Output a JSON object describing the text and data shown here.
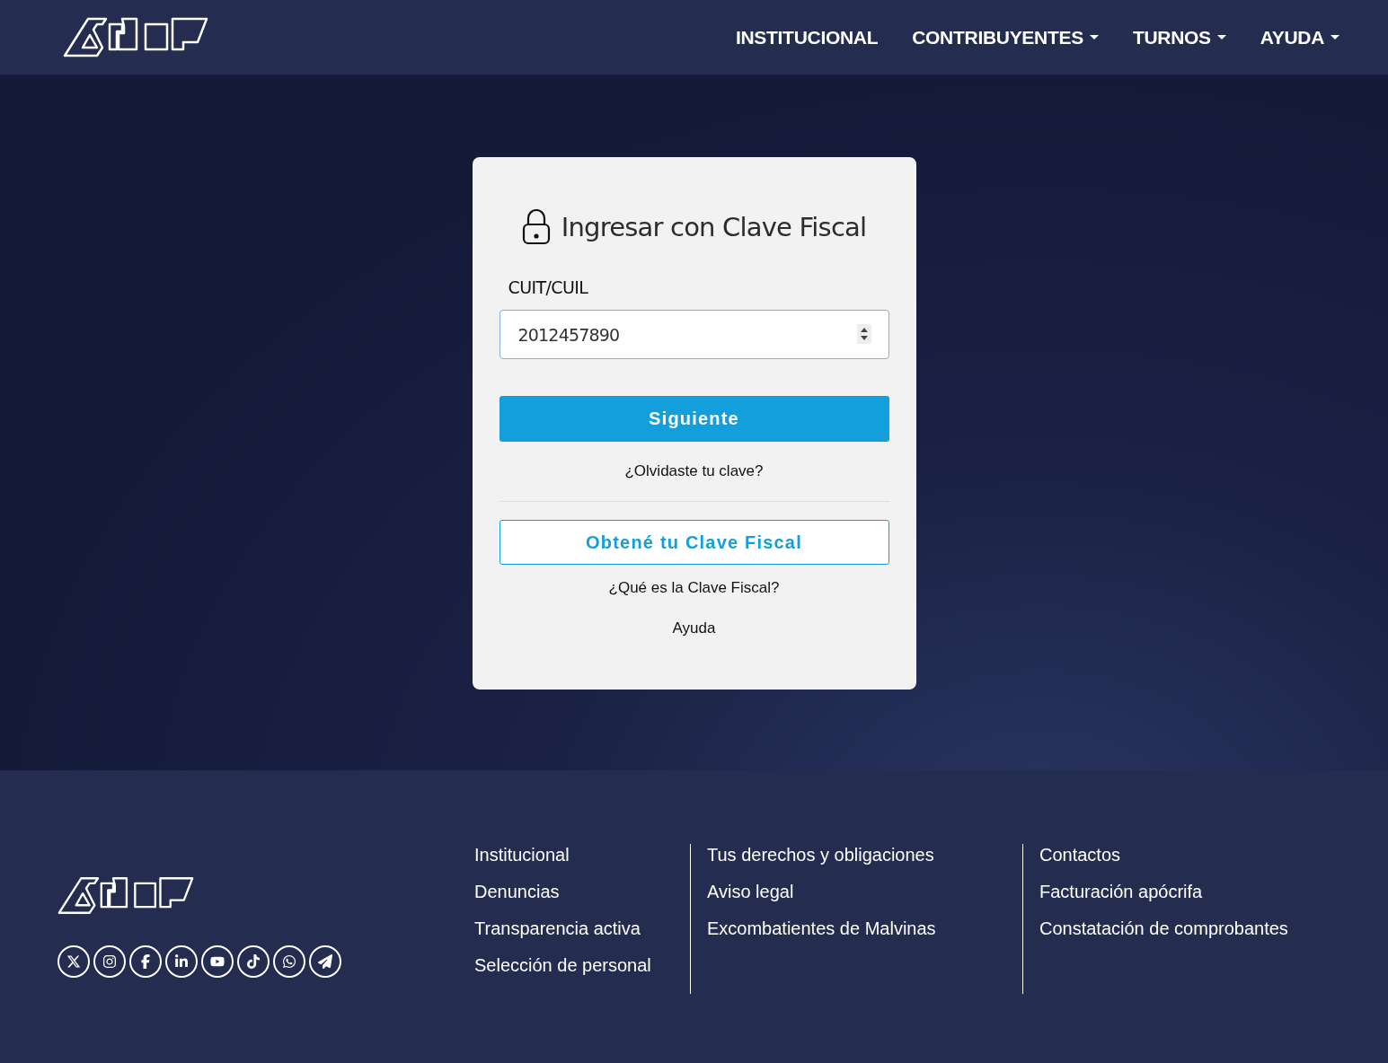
{
  "nav": {
    "items": [
      {
        "label": "INSTITUCIONAL",
        "has_dropdown": false
      },
      {
        "label": "CONTRIBUYENTES",
        "has_dropdown": true
      },
      {
        "label": "TURNOS",
        "has_dropdown": true
      },
      {
        "label": "AYUDA",
        "has_dropdown": true
      }
    ]
  },
  "login": {
    "title": "Ingresar con Clave Fiscal",
    "field_label": "CUIT/CUIL",
    "field_value": "2012457890",
    "submit": "Siguiente",
    "forgot_link": "¿Olvidaste tu clave?",
    "obtain_button": "Obtené tu Clave Fiscal",
    "links": [
      "¿Qué es la Clave Fiscal?",
      "Ayuda"
    ]
  },
  "footer": {
    "columns": [
      [
        "Institucional",
        "Denuncias",
        "Transparencia activa",
        "Selección de personal"
      ],
      [
        "Tus derechos y obligaciones",
        "Aviso legal",
        "Excombatientes de Malvinas"
      ],
      [
        "Contactos",
        "Facturación apócrifa",
        "Constatación de comprobantes"
      ]
    ]
  }
}
